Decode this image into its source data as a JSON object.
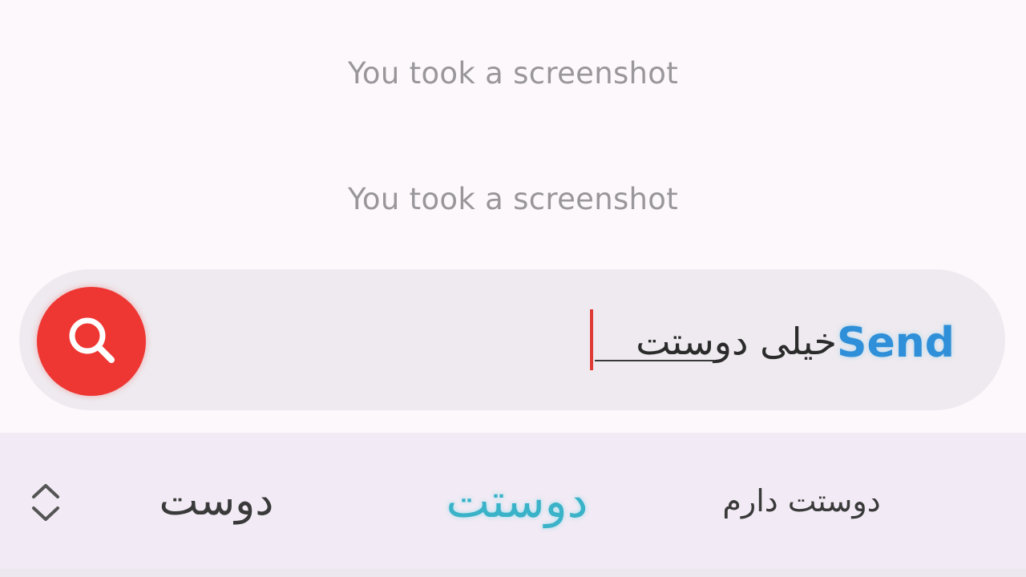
{
  "chat": {
    "system_messages": [
      "You took a screenshot",
      "You took a screenshot"
    ]
  },
  "composer": {
    "text": "خیلی دوستت",
    "send_label": "Send",
    "search_icon": "search-icon",
    "accent_color": "#ee3733",
    "send_color": "#2f8fd8"
  },
  "suggestions": {
    "expand_icon": "chevron-up-down-icon",
    "items": [
      "دوست",
      "دوستت",
      "دوستت دارم"
    ],
    "highlight_color": "#3ab2c8"
  }
}
